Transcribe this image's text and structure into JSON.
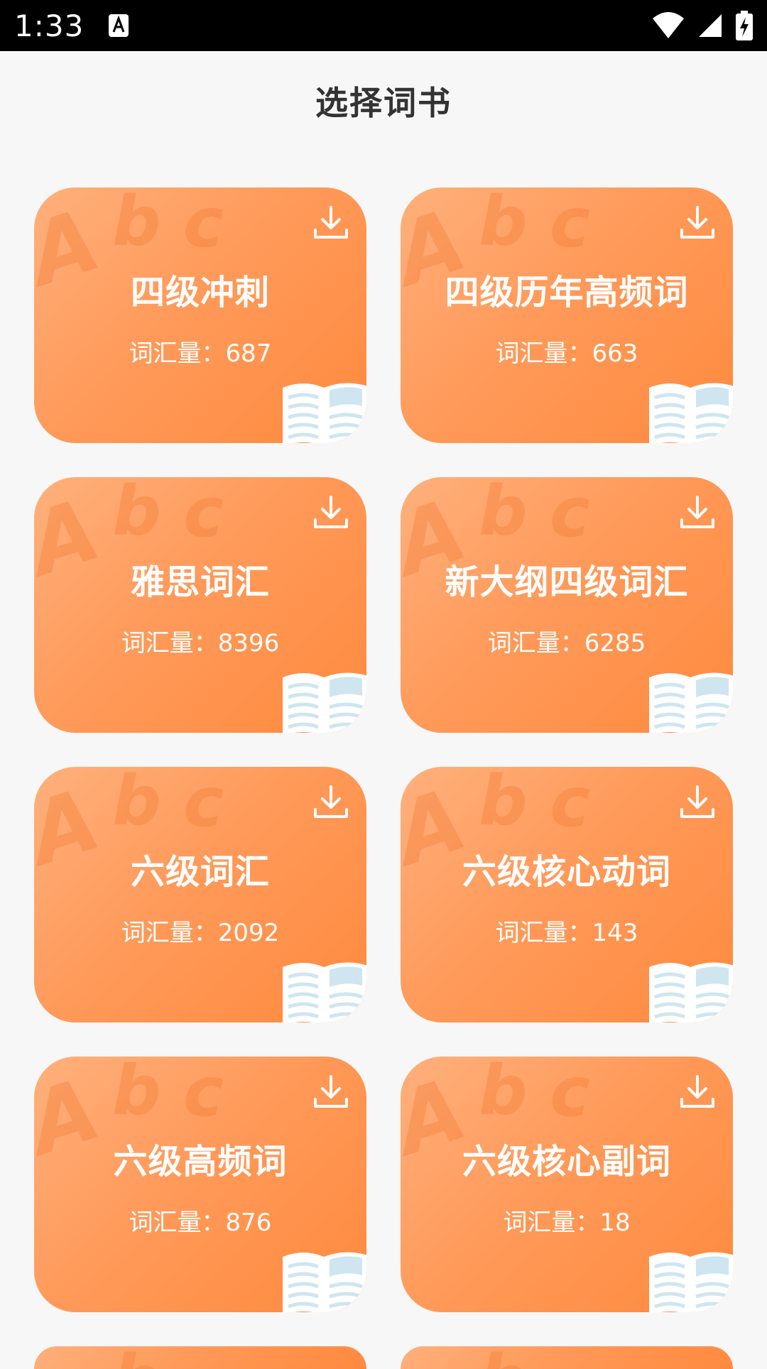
{
  "status_bar": {
    "time": "1:33",
    "icons": [
      "a-notification-icon",
      "wifi-icon",
      "signal-icon",
      "battery-charging-icon"
    ]
  },
  "header": {
    "title": "选择词书"
  },
  "colors": {
    "card_gradient_start": "#ffb07c",
    "card_gradient_end": "#ff8a3e",
    "title_text": "#333333",
    "background": "#f7f7f7"
  },
  "cards": [
    {
      "title": "四级冲刺",
      "count": "词汇量：687"
    },
    {
      "title": "四级历年高频词",
      "count": "词汇量：663"
    },
    {
      "title": "雅思词汇",
      "count": "词汇量：8396"
    },
    {
      "title": "新大纲四级词汇",
      "count": "词汇量：6285"
    },
    {
      "title": "六级词汇",
      "count": "词汇量：2092"
    },
    {
      "title": "六级核心动词",
      "count": "词汇量：143"
    },
    {
      "title": "六级高频词",
      "count": "词汇量：876"
    },
    {
      "title": "六级核心副词",
      "count": "词汇量：18"
    }
  ],
  "decor": {
    "letter_a": "A",
    "letter_b": "b",
    "letter_c": "c"
  }
}
